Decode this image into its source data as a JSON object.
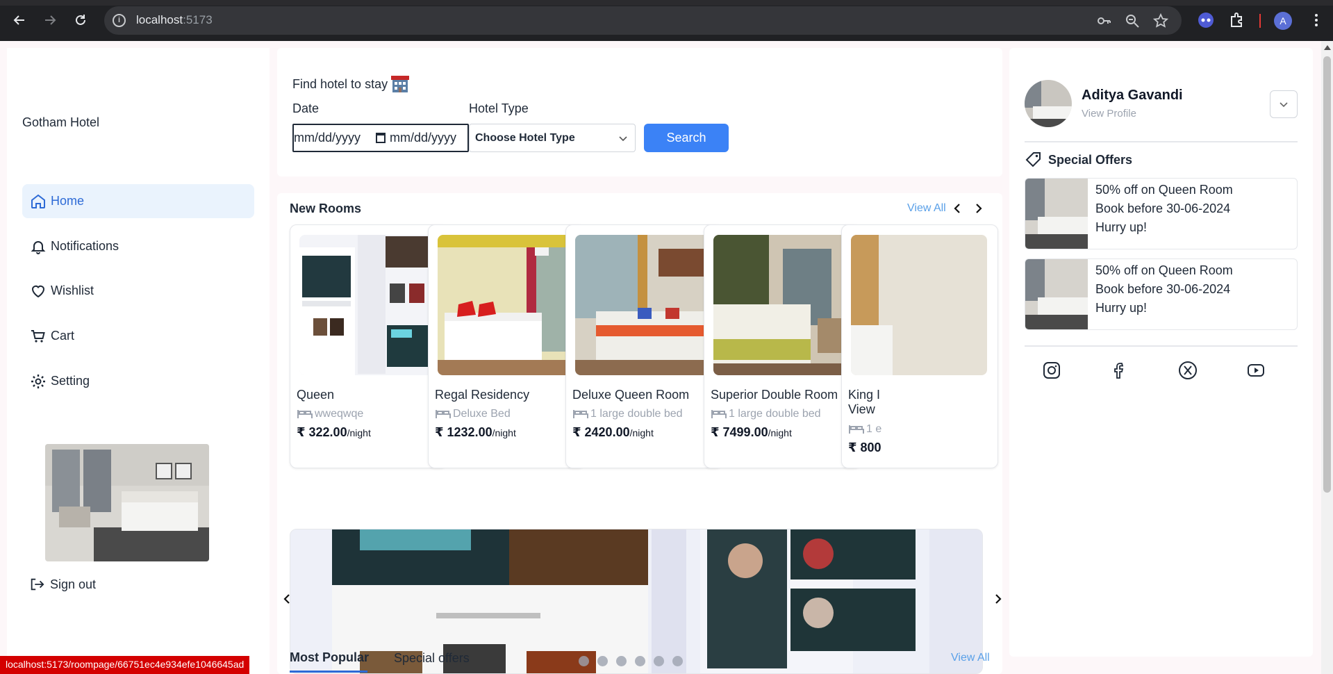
{
  "browser": {
    "url_host": "localhost",
    "url_port": ":5173",
    "profile_initial": "A"
  },
  "sidebar": {
    "brand": "Gotham Hotel",
    "items": [
      {
        "label": "Home",
        "icon": "home-icon",
        "active": true
      },
      {
        "label": "Notifications",
        "icon": "bell-icon"
      },
      {
        "label": "Wishlist",
        "icon": "heart-icon"
      },
      {
        "label": "Cart",
        "icon": "cart-icon"
      },
      {
        "label": "Setting",
        "icon": "gear-icon"
      }
    ],
    "signout_label": "Sign out"
  },
  "search": {
    "title": "Find hotel to stay",
    "date_label": "Date",
    "date_placeholder_start": "mm/dd/yyyy",
    "date_placeholder_end": "mm/dd/yyyy",
    "type_label": "Hotel Type",
    "type_value": "Choose Hotel Type",
    "button_label": "Search"
  },
  "new_rooms": {
    "title": "New Rooms",
    "view_all": "View All",
    "rooms": [
      {
        "name": "Queen",
        "bed": "wweqwqe",
        "price": "₹ 322.00",
        "unit": "/night"
      },
      {
        "name": "Regal Residency",
        "bed": "Deluxe Bed",
        "price": "₹ 1232.00",
        "unit": "/night"
      },
      {
        "name": "Deluxe Queen Room",
        "bed": "1 large double bed",
        "price": "₹ 2420.00",
        "unit": "/night"
      },
      {
        "name": "Superior Double Room",
        "bed": "1 large double bed",
        "price": "₹ 7499.00",
        "unit": "/night"
      },
      {
        "name": "King I",
        "name2": "View",
        "bed": "1 e",
        "price": "₹ 800",
        "unit": ""
      }
    ]
  },
  "carousel": {
    "dots": 6,
    "active_dot": 0
  },
  "tabs": {
    "popular": "Most Popular",
    "offers": "Special offers",
    "view_all": "View All"
  },
  "profile": {
    "name": "Aditya Gavandi",
    "link": "View Profile"
  },
  "special_offers": {
    "title": "Special Offers",
    "offers": [
      {
        "line1": "50% off on Queen Room",
        "line2": "Book before 30-06-2024",
        "line3": "Hurry up!"
      },
      {
        "line1": "50% off on Queen Room",
        "line2": "Book before 30-06-2024",
        "line3": "Hurry up!"
      }
    ]
  },
  "social": [
    "instagram-icon",
    "facebook-icon",
    "x-twitter-icon",
    "youtube-icon"
  ],
  "status_bar": "localhost:5173/roompage/66751ec4e934efe1046645ad",
  "colors": {
    "accent": "#3b82f6",
    "active_bg": "#eaf3fd",
    "link": "#5aa0e8",
    "status_red": "#d40000"
  }
}
